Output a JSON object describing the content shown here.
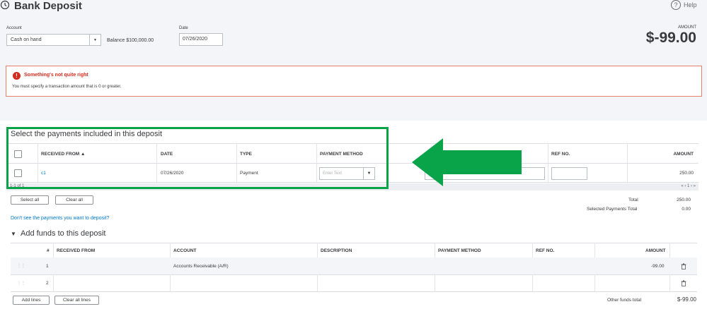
{
  "header": {
    "title": "Bank Deposit",
    "help_label": "Help",
    "account_label": "Account",
    "account_value": "Cash on hand",
    "balance_text": "Balance $100,000.00",
    "date_label": "Date",
    "date_value": "07/26/2020",
    "amount_label": "AMOUNT",
    "amount_value": "$-99.00"
  },
  "error": {
    "title": "Something's not quite right",
    "message": "You must specify a transaction amount that is 0 or greater."
  },
  "payments": {
    "section_title": "Select the payments included in this deposit",
    "columns": [
      "RECEIVED FROM ▲",
      "DATE",
      "TYPE",
      "PAYMENT METHOD",
      "REF NO.",
      "AMOUNT"
    ],
    "rows": [
      {
        "received_from": "c1",
        "date": "07/26/2020",
        "type": "Payment",
        "method_placeholder": "Enter Text",
        "amount": "250.00"
      }
    ],
    "pager_left": "1-1 of 1",
    "pager_right": "« ‹ 1 › »",
    "select_all": "Select all",
    "clear_all": "Clear all",
    "total_label": "Total",
    "total_value": "250.00",
    "selected_label": "Selected Payments Total",
    "selected_value": "0.00",
    "dont_see_link": "Don't see the payments you want to deposit?"
  },
  "add_funds": {
    "section_title": "Add funds to this deposit",
    "columns": [
      "#",
      "RECEIVED FROM",
      "ACCOUNT",
      "DESCRIPTION",
      "PAYMENT METHOD",
      "REF NO.",
      "AMOUNT"
    ],
    "rows": [
      {
        "num": "1",
        "account": "Accounts Receivable (A/R)",
        "amount": "-99.00"
      },
      {
        "num": "2",
        "account": "",
        "amount": ""
      }
    ],
    "add_lines": "Add lines",
    "clear_all_lines": "Clear all lines",
    "other_total_label": "Other funds total",
    "other_total_value": "$-99.00"
  },
  "colors": {
    "annotation_green": "#09a34a",
    "error_red": "#d52b1e",
    "link_blue": "#0077c5"
  }
}
